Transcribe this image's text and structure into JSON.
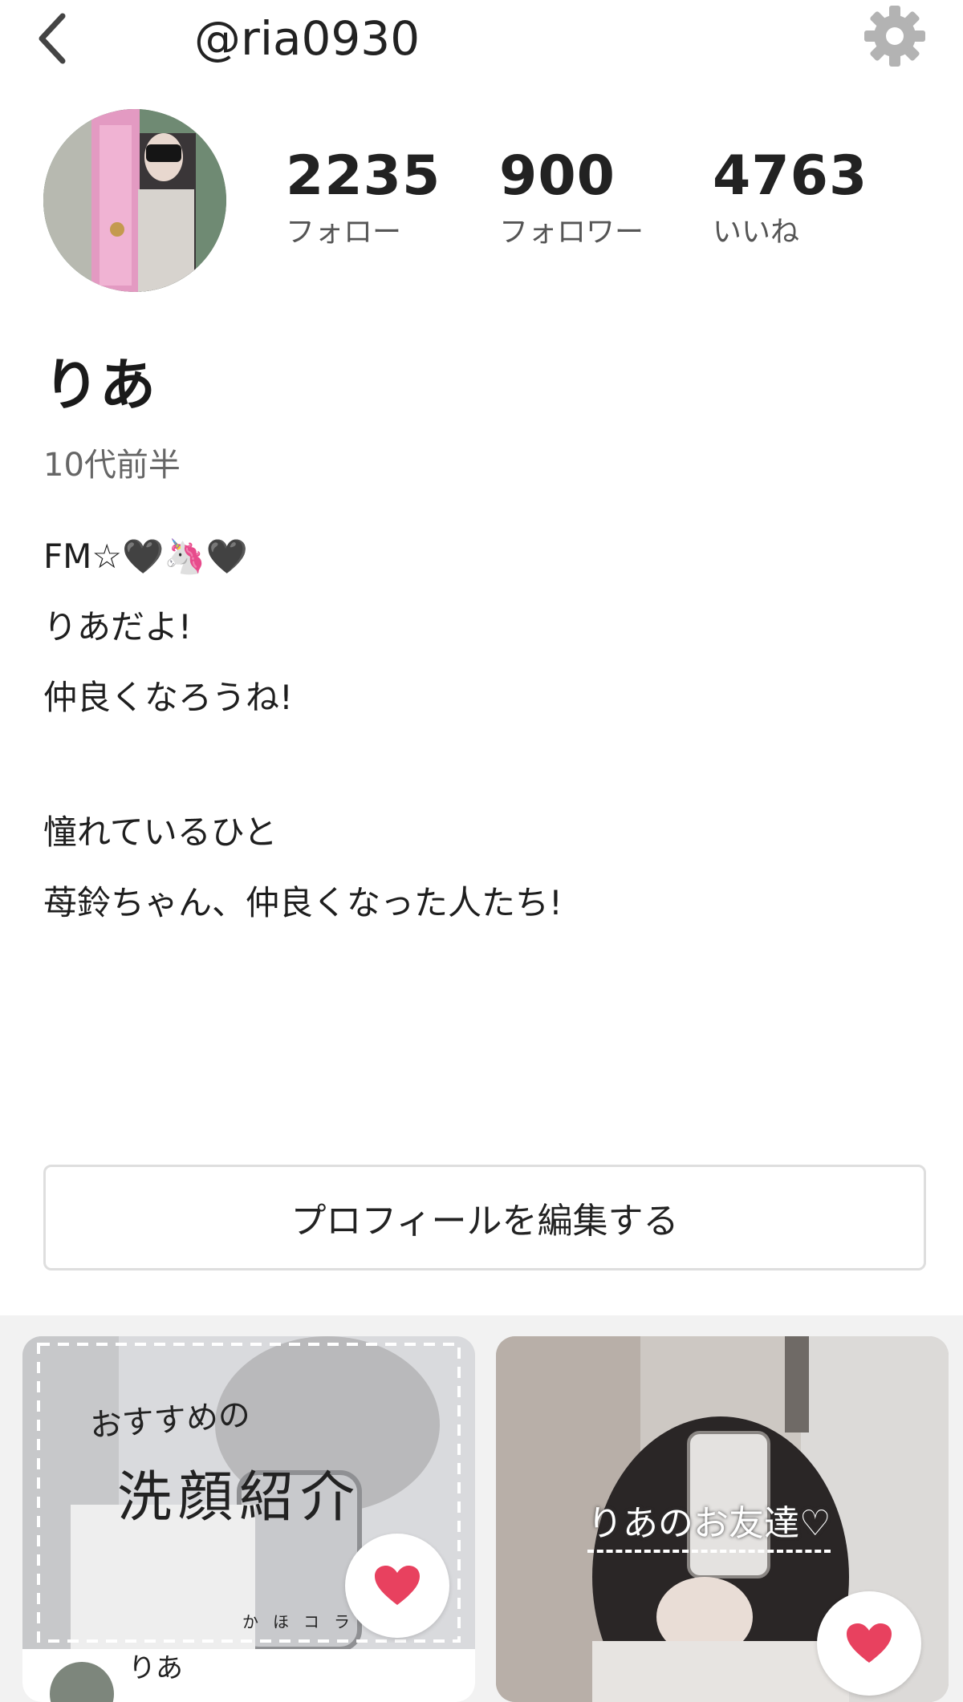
{
  "header": {
    "handle": "@ria0930"
  },
  "stats": {
    "follow": {
      "value": "2235",
      "label": "フォロー"
    },
    "followers": {
      "value": "900",
      "label": "フォロワー"
    },
    "likes": {
      "value": "4763",
      "label": "いいね"
    }
  },
  "profile": {
    "name": "りあ",
    "age": "10代前半",
    "bio": [
      "FM☆🖤🦄🖤",
      "りあだよ!",
      "仲良くなろうね!",
      "",
      "憧れているひと",
      "苺鈴ちゃん、仲良くなった人たち!"
    ]
  },
  "actions": {
    "edit_profile": "プロフィールを編集する"
  },
  "posts": [
    {
      "title_small": "おすすめの",
      "title_large": "洗顔紹介",
      "watermark": "かほコラ",
      "author": "りあ"
    },
    {
      "title": "りあのお友達♡"
    }
  ],
  "colors": {
    "heart": "#e8415f",
    "accent_border": "#dedede"
  }
}
